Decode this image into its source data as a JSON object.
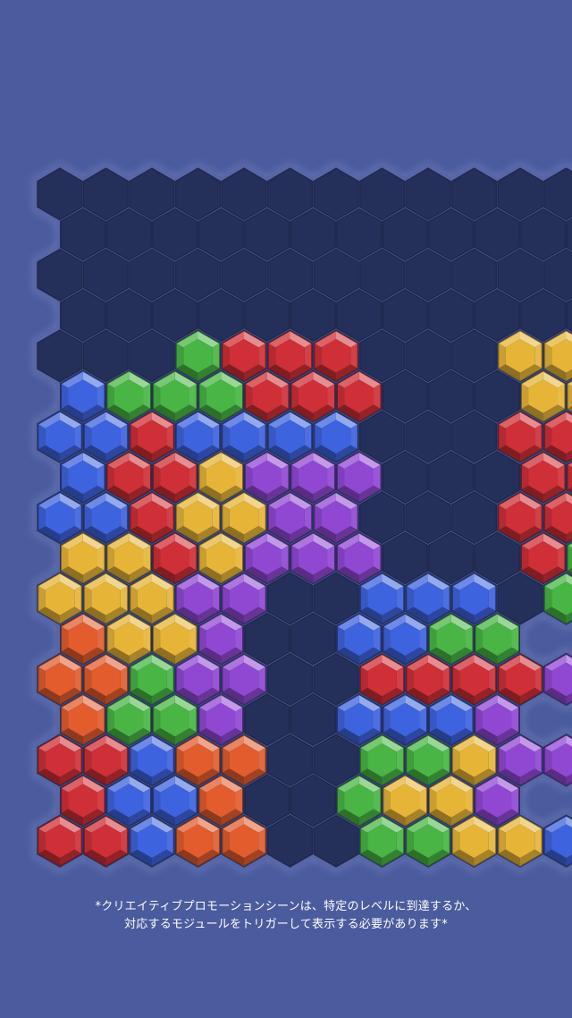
{
  "colors": {
    "background": "#4a5b9e",
    "board_frame": "#5766a7",
    "empty_cell": "#25305a",
    "blue": "#3e63de",
    "red": "#cf2f36",
    "green": "#48b544",
    "yellow": "#e6b437",
    "purple": "#9048d3",
    "orange": "#e25c2e"
  },
  "board": {
    "rows": [
      ".............",
      "............",
      ".............",
      "............",
      "...GRRR...YY.",
      "BGGGRRR...YY",
      "BBRBBBB...RR.",
      "BRRYPPP...RR",
      "BBRYYPP...RR.",
      "YYRYPPP...RG",
      "YYYPP..BBB.GG",
      "OYYP..BBGG",
      "OOGPP..RRRRP",
      "OGGP..BBBP",
      "RRBOO..GGYPP",
      "RBBO..GYYP",
      "RRBOO..GGYYB"
    ],
    "color_key": {
      ".": "empty",
      "B": "blue",
      "R": "red",
      "G": "green",
      "Y": "yellow",
      "P": "purple",
      "O": "orange"
    }
  },
  "disclaimer": {
    "line1": "*クリエイティブプロモーションシーンは、特定のレベルに到達するか、",
    "line2": "対応するモジュールをトリガーして表示する必要があります*"
  }
}
